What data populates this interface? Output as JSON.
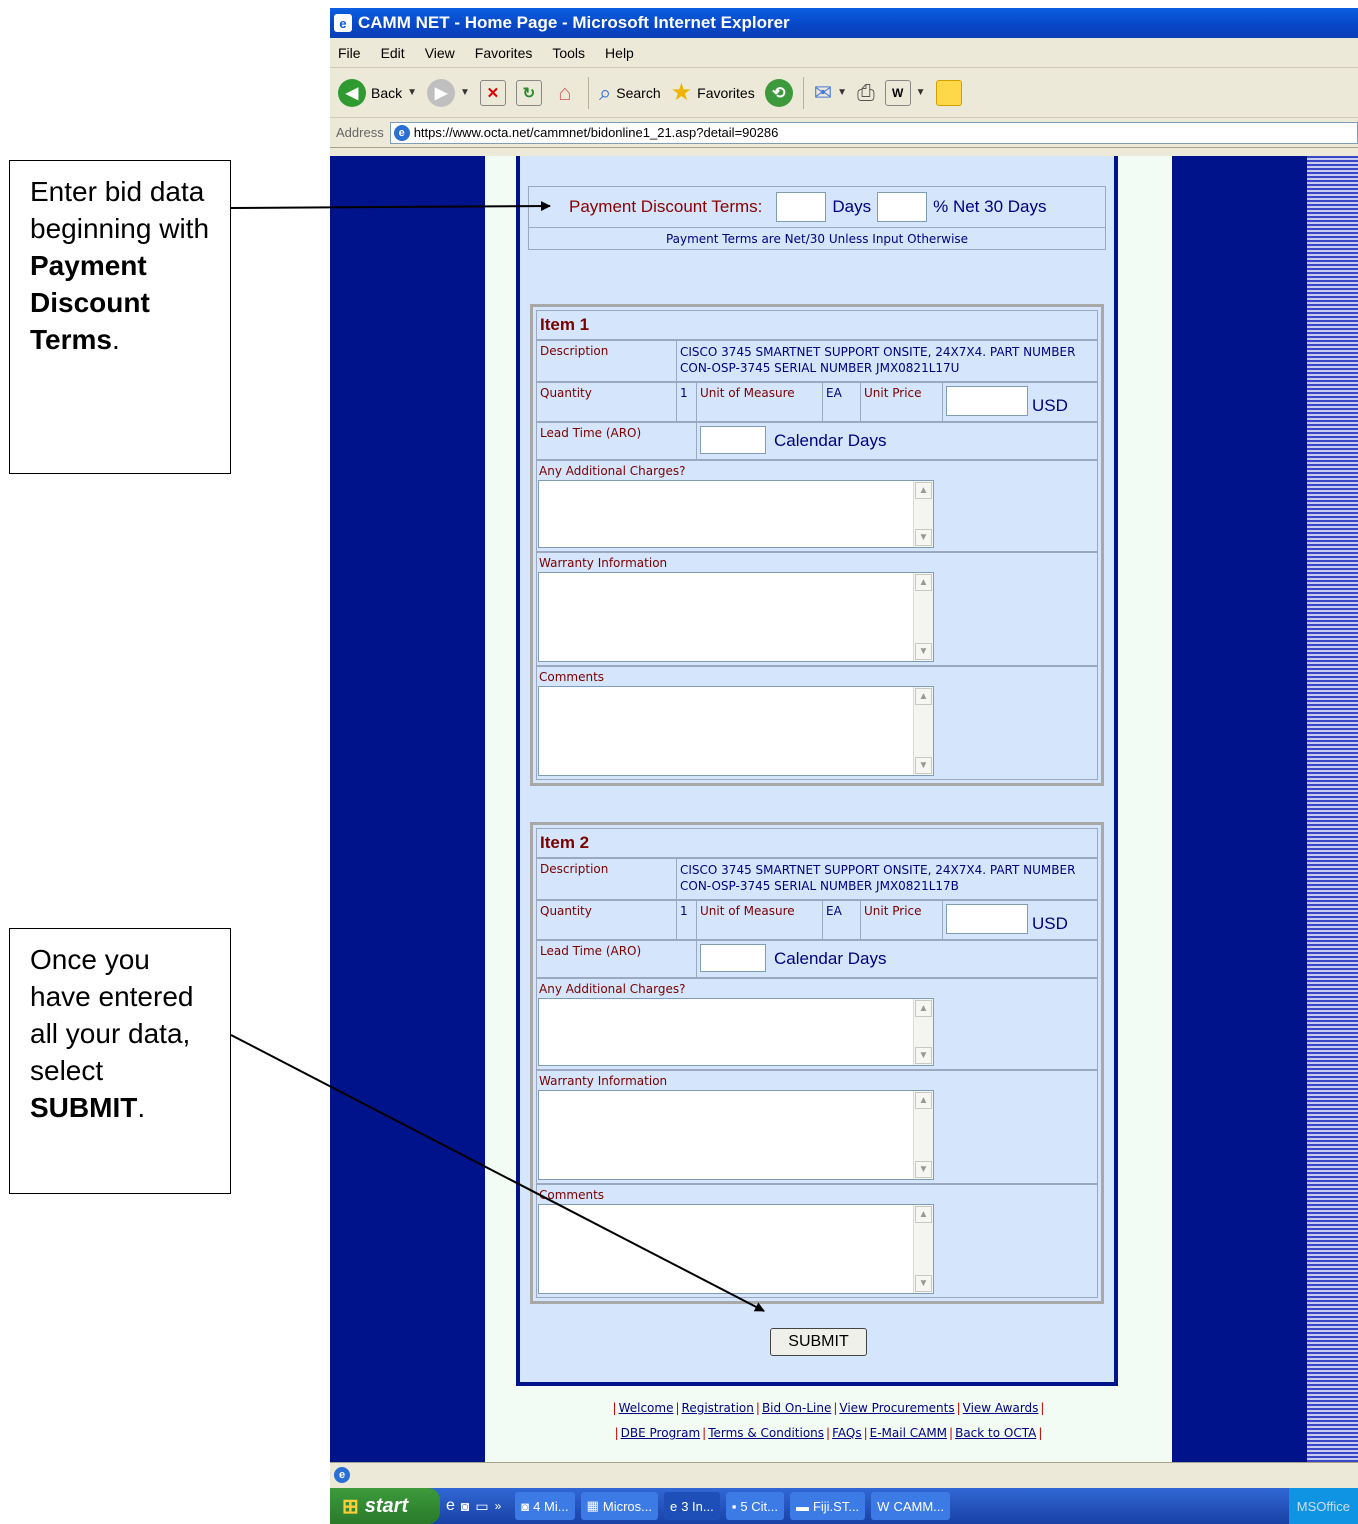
{
  "callouts": {
    "first": {
      "line1": "Enter bid data beginning with",
      "bold": "Payment Discount Terms",
      "end": "."
    },
    "second": {
      "line1": "Once you have entered all your data, select",
      "bold": "SUBMIT",
      "end": "."
    }
  },
  "browser": {
    "title": "CAMM NET - Home Page - Microsoft Internet Explorer",
    "menu": [
      "File",
      "Edit",
      "View",
      "Favorites",
      "Tools",
      "Help"
    ],
    "toolbar": {
      "back": "Back",
      "search": "Search",
      "favorites": "Favorites"
    },
    "address_label": "Address",
    "url": "https://www.octa.net/cammnet/bidonline1_21.asp?detail=90286"
  },
  "payment": {
    "label": "Payment Discount Terms:",
    "days": "Days",
    "net": "% Net 30 Days",
    "note": "Payment Terms are Net/30 Unless Input Otherwise"
  },
  "items": [
    {
      "title": "Item 1",
      "description_label": "Description",
      "description": "CISCO 3745 SMARTNET SUPPORT ONSITE, 24X7X4. PART NUMBER CON-OSP-3745 SERIAL NUMBER JMX0821L17U",
      "quantity_label": "Quantity",
      "quantity": "1",
      "uom_label": "Unit of Measure",
      "uom": "EA",
      "price_label": "Unit Price",
      "currency": "USD",
      "lead_label": "Lead Time (ARO)",
      "lead_unit": "Calendar Days",
      "charges_label": "Any Additional Charges?",
      "warranty_label": "Warranty Information",
      "comments_label": "Comments"
    },
    {
      "title": "Item 2",
      "description_label": "Description",
      "description": "CISCO 3745 SMARTNET SUPPORT ONSITE, 24X7X4. PART NUMBER CON-OSP-3745 SERIAL NUMBER JMX0821L17B",
      "quantity_label": "Quantity",
      "quantity": "1",
      "uom_label": "Unit of Measure",
      "uom": "EA",
      "price_label": "Unit Price",
      "currency": "USD",
      "lead_label": "Lead Time (ARO)",
      "lead_unit": "Calendar Days",
      "charges_label": "Any Additional Charges?",
      "warranty_label": "Warranty Information",
      "comments_label": "Comments"
    }
  ],
  "submit_label": "SUBMIT",
  "footer_links_row1": [
    "Welcome",
    "Registration",
    "Bid On-Line",
    "View Procurements",
    "View Awards"
  ],
  "footer_links_row2": [
    "DBE Program",
    "Terms & Conditions",
    "FAQs",
    "E-Mail CAMM",
    "Back to OCTA"
  ],
  "taskbar": {
    "start": "start",
    "tasks": [
      "4 Mi...",
      "Micros...",
      "3 In...",
      "5 Cit...",
      "Fiji.ST...",
      "CAMM..."
    ],
    "tray": "MSOffice"
  }
}
